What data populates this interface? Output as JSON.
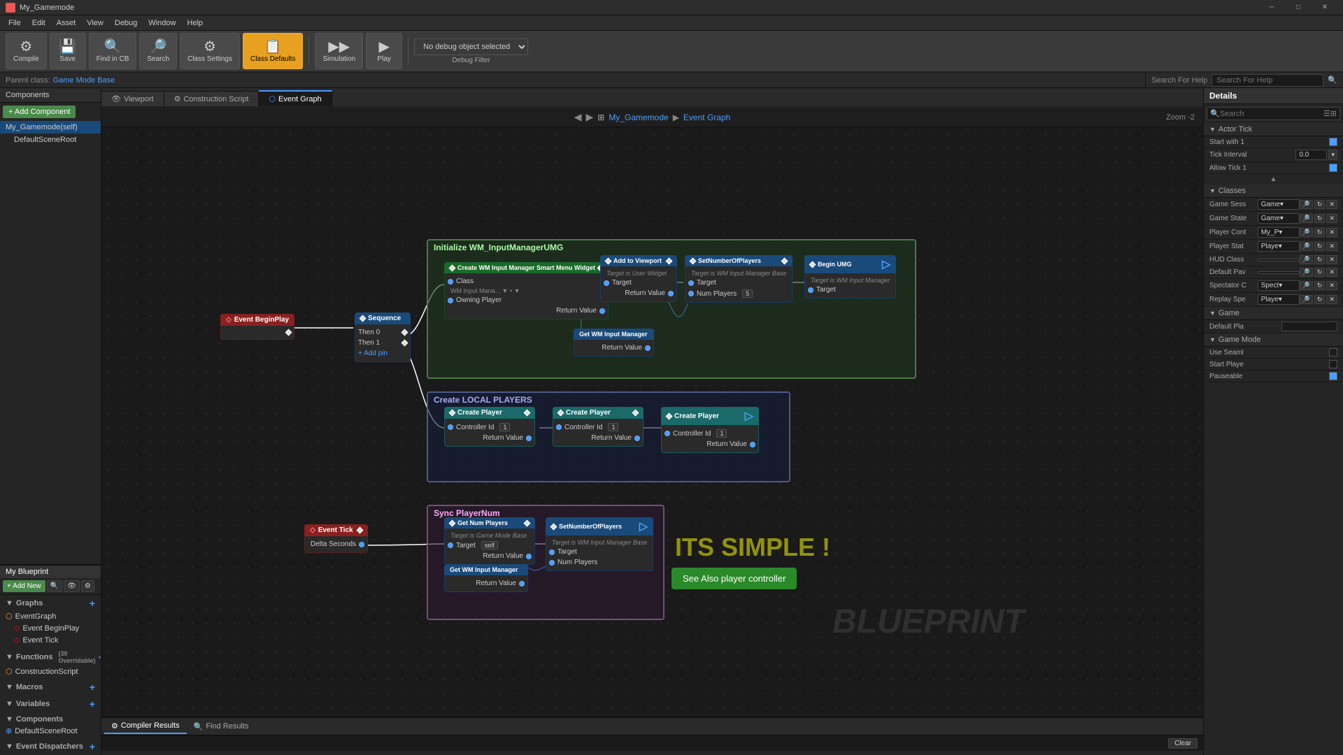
{
  "titlebar": {
    "icon_label": "UE",
    "title": "My_Gamemode",
    "minimize_label": "─",
    "maximize_label": "□",
    "close_label": "✕"
  },
  "menubar": {
    "items": [
      "File",
      "Edit",
      "Asset",
      "View",
      "Debug",
      "Window",
      "Help"
    ]
  },
  "toolbar": {
    "compile_label": "Compile",
    "save_label": "Save",
    "find_in_cb_label": "Find in CB",
    "search_label": "Search",
    "class_settings_label": "Class Settings",
    "class_defaults_label": "Class Defaults",
    "simulation_label": "Simulation",
    "play_label": "Play",
    "debug_selector": "No debug object selected",
    "debug_filter": "Debug Filter"
  },
  "parentbar": {
    "label": "Parent class:",
    "value": "Game Mode Base"
  },
  "help_search": {
    "placeholder": "Search For Help",
    "label": "Search For Help"
  },
  "breadcrumb": {
    "back_label": "◀",
    "forward_label": "▶",
    "grid_label": "⊞",
    "path1": "My_Gamemode",
    "arrow": "▶",
    "path2": "Event Graph",
    "zoom_label": "Zoom -2"
  },
  "tabs": {
    "viewport": "Viewport",
    "construction_script": "Construction Script",
    "event_graph": "Event Graph"
  },
  "left_panel": {
    "header": "Components",
    "add_component_label": "+ Add Component",
    "items": [
      {
        "label": "My_Gamemode(self)",
        "indent": false
      },
      {
        "label": "DefaultSceneRoot",
        "indent": true
      }
    ]
  },
  "my_blueprint": {
    "header": "My Blueprint",
    "add_new_label": "+ Add New",
    "search_placeholder": "Search",
    "graphs_header": "Graphs",
    "graphs_add": "+",
    "graph_items": [
      {
        "label": "EventGraph",
        "icon": "⬡"
      },
      {
        "label": "Event BeginPlay",
        "icon": "◇",
        "indent": true
      },
      {
        "label": "Event Tick",
        "icon": "◇",
        "indent": true
      }
    ],
    "functions_header": "Functions",
    "functions_count": "30 Overridable",
    "functions_add": "+",
    "function_items": [
      {
        "label": "ConstructionScript",
        "icon": "⬡"
      }
    ],
    "macros_header": "Macros",
    "macros_add": "+",
    "variables_header": "Variables",
    "variables_add": "+",
    "components_header": "Components",
    "component_items": [
      {
        "label": "DefaultSceneRoot",
        "icon": "⊕"
      }
    ],
    "event_dispatchers_header": "Event Dispatchers",
    "event_dispatchers_add": "+"
  },
  "right_panel": {
    "header": "Details",
    "search_placeholder": "Search",
    "actor_tick_section": "Actor Tick",
    "start_with_tick": "Start with 1",
    "tick_interval_label": "Tick Interval",
    "tick_interval_value": "0.0",
    "allow_tick_label": "Allow Tick 1",
    "classes_section": "Classes",
    "game_sess_label": "Game Sess",
    "game_sess_value": "Game▾",
    "game_state_label": "Game State",
    "game_state_value": "Game▾",
    "player_cont_label": "Player Cont",
    "player_cont_value": "My_P▾",
    "player_stat_label": "Player Stat",
    "player_stat_value": "Playe▾",
    "hud_class_label": "HUD Class",
    "default_pav_label": "Default Pav",
    "spectator_label": "Spectator C",
    "spectator_value": "Spect▾",
    "replay_spe_label": "Replay Spe",
    "replay_spe_value": "Playe▾",
    "game_section": "Game",
    "default_pla_label": "Default Pla",
    "game_mode_section": "Game Mode",
    "use_seaml_label": "Use Seaml",
    "start_playe_label": "Start Playe",
    "pauseable_label": "Pauseable"
  },
  "canvas": {
    "comment1": {
      "title": "Initialize WM_InputManagerUMG",
      "color": "green"
    },
    "comment2": {
      "title": "Create LOCAL PLAYERS",
      "color": "blue"
    },
    "comment3": {
      "title": "Sync PlayerNum",
      "color": "purple"
    },
    "text_big": "BLUEPRINT",
    "text_simple": "ITS SIMPLE !",
    "see_also_label": "See Also player controller"
  },
  "bottom_panel": {
    "compiler_results": "Compiler Results",
    "find_results": "Find Results",
    "clear_label": "Clear"
  },
  "nodes": {
    "event_begin_play": "Event BeginPlay",
    "sequence": "Sequence",
    "create_wm": "Create WM Input Manager Smart Menu Widget",
    "add_to_viewport": "Add to Viewport",
    "set_number_of_players": "SetNumberOfPlayers",
    "begin_umg": "Begin UMG",
    "get_wm_input": "Get WM Input Manager",
    "create_player1": "Create Player",
    "create_player2": "Create Player",
    "create_player3": "Create Player",
    "event_tick": "Event Tick",
    "get_num_players": "Get Num Players",
    "set_number_of_players2": "SetNumberOfPlayers",
    "get_wm_input2": "Get WM Input Manager"
  }
}
